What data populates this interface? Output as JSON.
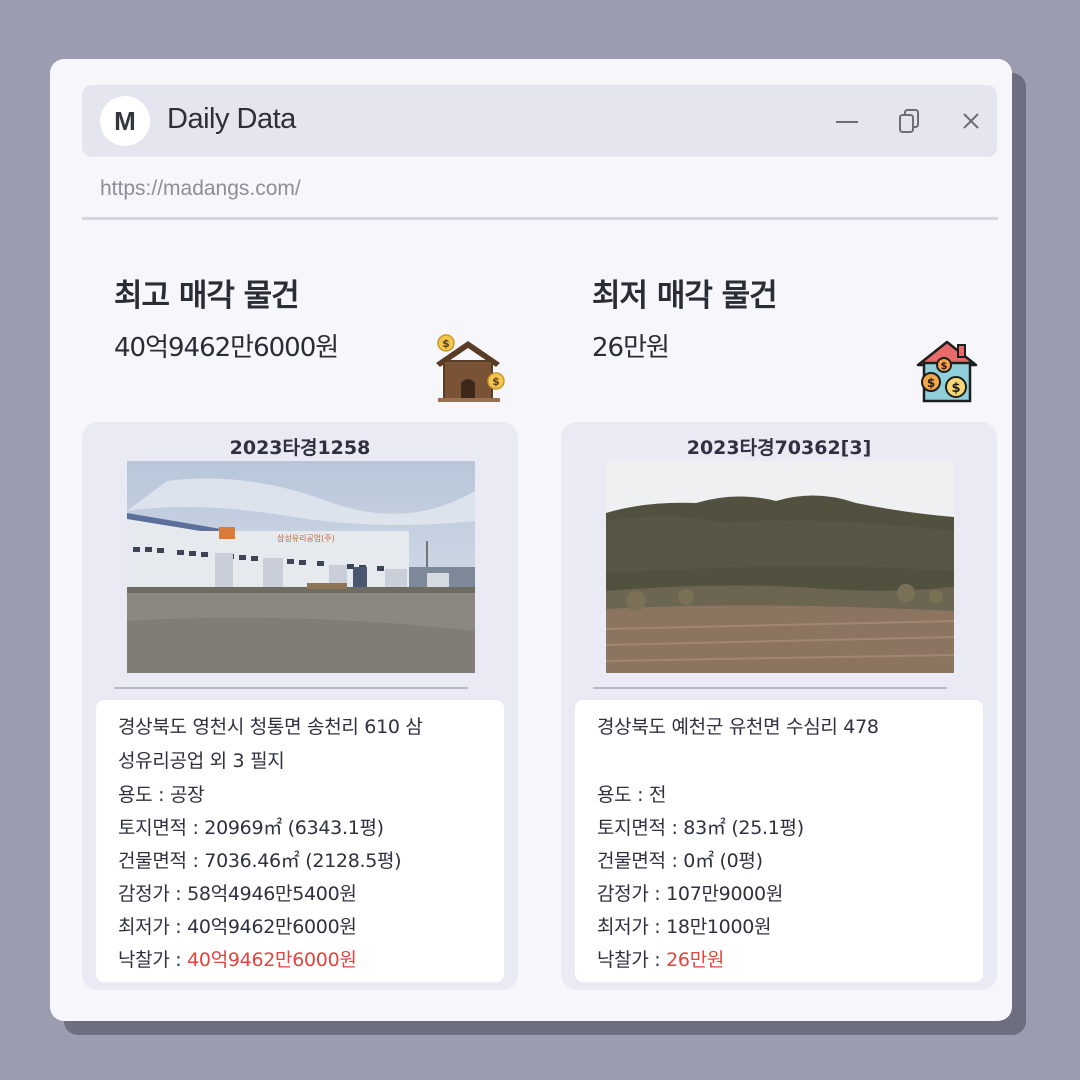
{
  "window": {
    "avatar_letter": "M",
    "title": "Daily Data",
    "url": "https://madangs.com/"
  },
  "highest": {
    "heading": "최고 매각 물건",
    "amount": "40억9462만6000원",
    "case_no": "2023타경1258",
    "address_line1": "경상북도 영천시 청통면 송천리 610 삼",
    "address_line2": "성유리공업 외 3 필지",
    "usage": "용도 : 공장",
    "land_area": "토지면적 : 20969㎡ (6343.1평)",
    "building_area": "건물면적 : 7036.46㎡ (2128.5평)",
    "appraisal": "감정가 : 58억4946만5400원",
    "minimum": "최저가 : 40억9462만6000원",
    "winning_label": "낙찰가 : ",
    "winning_value": "40억9462만6000원",
    "photo_sign": "삼성유리공업(주)"
  },
  "lowest": {
    "heading": "최저 매각 물건",
    "amount": "26만원",
    "case_no": "2023타경70362[3]",
    "address_line1": "경상북도 예천군 유천면 수심리 478",
    "address_line2": "",
    "usage": "용도 : 전",
    "land_area": "토지면적 : 83㎡ (25.1평)",
    "building_area": "건물면적 : 0㎡ (0평)",
    "appraisal": "감정가 : 107만9000원",
    "minimum": "최저가 : 18만1000원",
    "winning_label": "낙찰가 : ",
    "winning_value": "26만원"
  },
  "icons": {
    "minimize": "minimize-icon",
    "copy": "copy-icon",
    "close": "close-icon",
    "house_money_brown": "house-money-icon",
    "house_money_blue": "house-coins-icon"
  },
  "colors": {
    "background": "#9b9cb0",
    "window": "#f6f6fb",
    "titlebar": "#e4e5ee",
    "card": "#e9eaf4",
    "price_red": "#e2443f"
  }
}
